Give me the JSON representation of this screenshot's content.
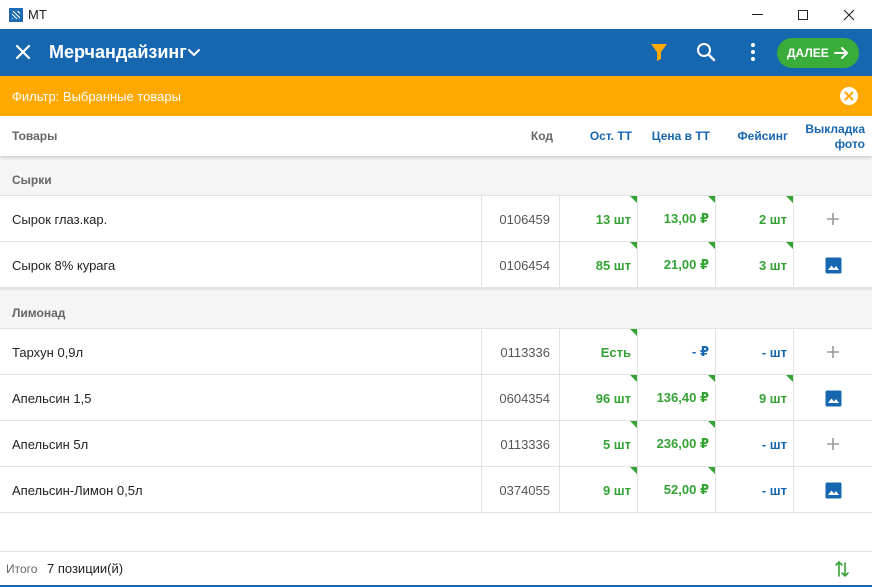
{
  "window": {
    "title": "МТ"
  },
  "toolbar": {
    "title": "Мерчандайзинг",
    "next_label": "ДАЛЕЕ",
    "colors": {
      "bar": "#1767b0",
      "filter_icon": "#ffa800",
      "next_button": "#3aac3a"
    }
  },
  "banner": {
    "text": "Фильтр: Выбранные товары",
    "color": "#ffa800"
  },
  "table": {
    "headers": {
      "name": "Товары",
      "code": "Код",
      "stock": "Ост. ТТ",
      "price": "Цена в ТТ",
      "facing": "Фейсинг",
      "photo_line1": "Выкладка",
      "photo_line2": "фото"
    },
    "groups": [
      {
        "name": "Сырки",
        "rows": [
          {
            "name": "Сырок глаз.кар.",
            "code": "0106459",
            "stock": "13 шт",
            "price": "13,00 ₽",
            "facing": "2 шт",
            "photo": "add"
          },
          {
            "name": "Сырок 8% курага",
            "code": "0106454",
            "stock": "85 шт",
            "price": "21,00 ₽",
            "facing": "3 шт",
            "photo": "image"
          }
        ]
      },
      {
        "name": "Лимонад",
        "rows": [
          {
            "name": "Тархун 0,9л",
            "code": "0113336",
            "stock": "Есть",
            "price": "- ₽",
            "facing": "- шт",
            "photo": "add"
          },
          {
            "name": "Апельсин 1,5",
            "code": "0604354",
            "stock": "96 шт",
            "price": "136,40 ₽",
            "facing": "9 шт",
            "photo": "image"
          },
          {
            "name": "Апельсин 5л",
            "code": "0113336",
            "stock": "5 шт",
            "price": "236,00 ₽",
            "facing": "- шт",
            "photo": "add"
          },
          {
            "name": "Апельсин-Лимон 0,5л",
            "code": "0374055",
            "stock": "9 шт",
            "price": "52,00 ₽",
            "facing": "- шт",
            "photo": "image"
          }
        ]
      }
    ]
  },
  "footer": {
    "label": "Итого",
    "count": "7 позиции(й)"
  }
}
